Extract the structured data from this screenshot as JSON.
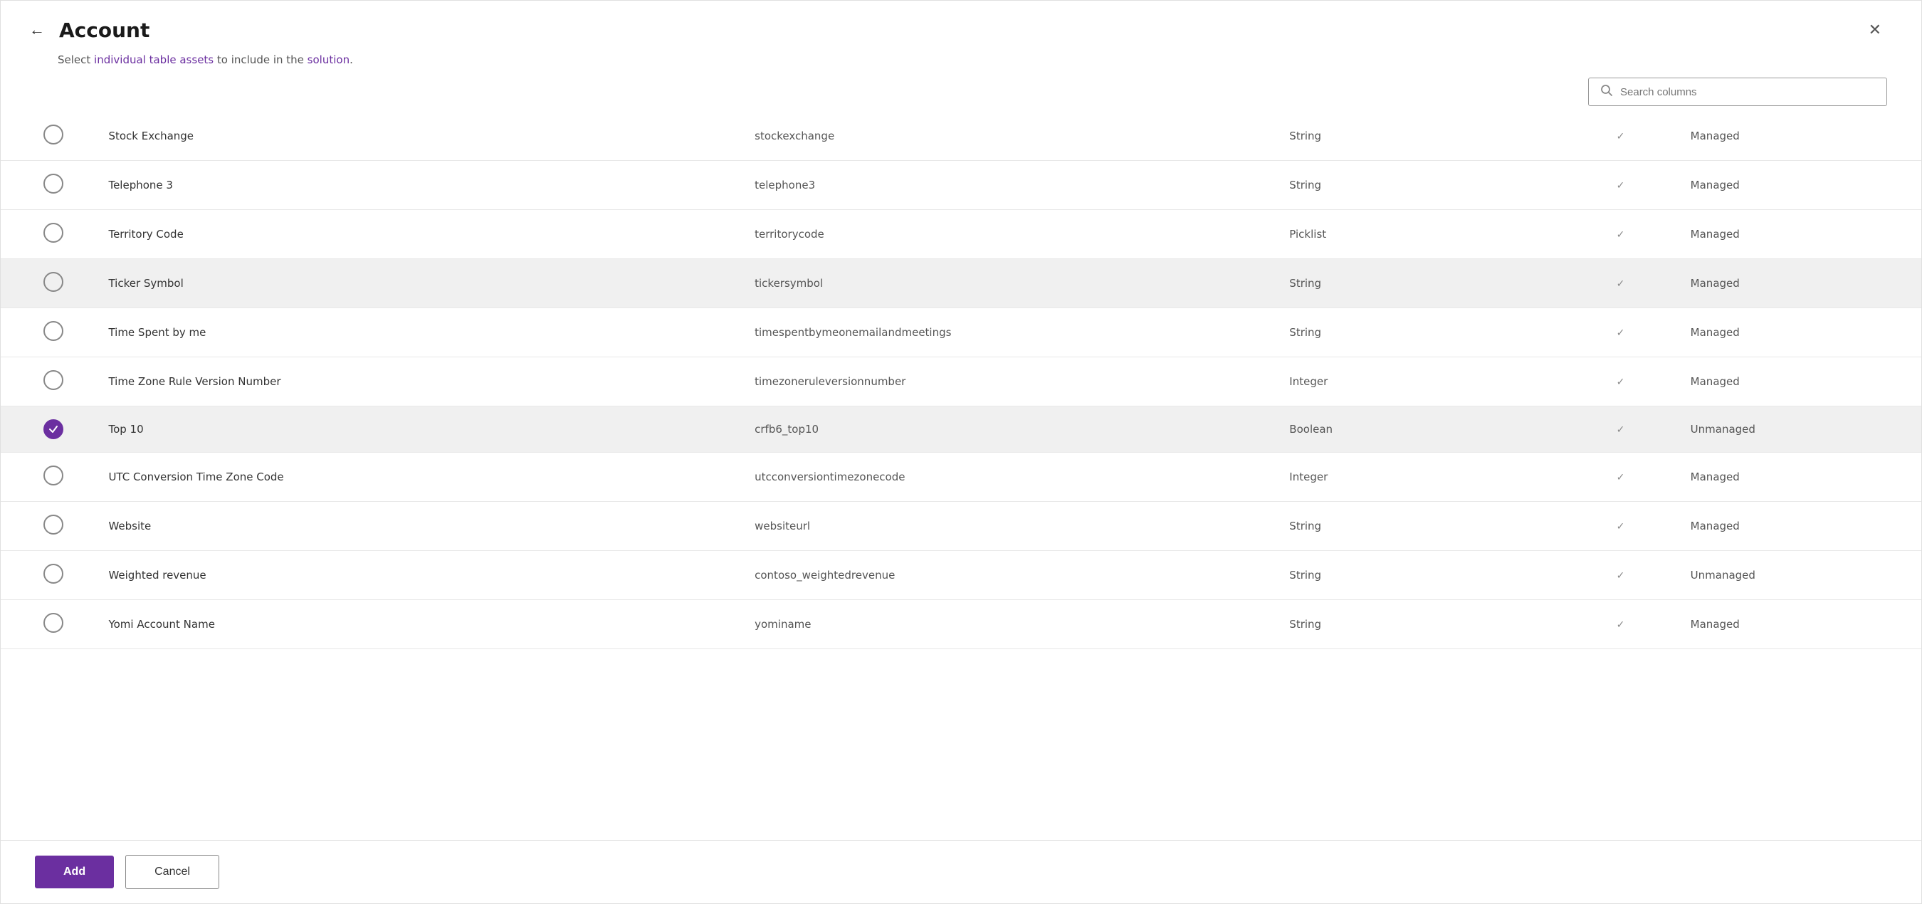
{
  "header": {
    "title": "Account",
    "back_label": "←",
    "close_label": "✕"
  },
  "subtitle": {
    "text_before": "Select ",
    "highlight1": "individual table assets",
    "text_middle": " to include in the ",
    "highlight2": "solution",
    "text_after": "."
  },
  "search": {
    "placeholder": "Search columns"
  },
  "rows": [
    {
      "id": 1,
      "name": "Stock Exchange",
      "logical": "stockexchange",
      "type": "String",
      "has_check": true,
      "managed": "Managed",
      "selected": false,
      "highlighted": false
    },
    {
      "id": 2,
      "name": "Telephone 3",
      "logical": "telephone3",
      "type": "String",
      "has_check": true,
      "managed": "Managed",
      "selected": false,
      "highlighted": false
    },
    {
      "id": 3,
      "name": "Territory Code",
      "logical": "territorycode",
      "type": "Picklist",
      "has_check": true,
      "managed": "Managed",
      "selected": false,
      "highlighted": false
    },
    {
      "id": 4,
      "name": "Ticker Symbol",
      "logical": "tickersymbol",
      "type": "String",
      "has_check": true,
      "managed": "Managed",
      "selected": false,
      "highlighted": true
    },
    {
      "id": 5,
      "name": "Time Spent by me",
      "logical": "timespentbymeonemailandmeetings",
      "type": "String",
      "has_check": true,
      "managed": "Managed",
      "selected": false,
      "highlighted": false
    },
    {
      "id": 6,
      "name": "Time Zone Rule Version Number",
      "logical": "timezoneruleversionnumber",
      "type": "Integer",
      "has_check": true,
      "managed": "Managed",
      "selected": false,
      "highlighted": false
    },
    {
      "id": 7,
      "name": "Top 10",
      "logical": "crfb6_top10",
      "type": "Boolean",
      "has_check": true,
      "managed": "Unmanaged",
      "selected": true,
      "highlighted": true
    },
    {
      "id": 8,
      "name": "UTC Conversion Time Zone Code",
      "logical": "utcconversiontimezonecode",
      "type": "Integer",
      "has_check": true,
      "managed": "Managed",
      "selected": false,
      "highlighted": false
    },
    {
      "id": 9,
      "name": "Website",
      "logical": "websiteurl",
      "type": "String",
      "has_check": true,
      "managed": "Managed",
      "selected": false,
      "highlighted": false
    },
    {
      "id": 10,
      "name": "Weighted revenue",
      "logical": "contoso_weightedrevenue",
      "type": "String",
      "has_check": true,
      "managed": "Unmanaged",
      "selected": false,
      "highlighted": false
    },
    {
      "id": 11,
      "name": "Yomi Account Name",
      "logical": "yominame",
      "type": "String",
      "has_check": true,
      "managed": "Managed",
      "selected": false,
      "highlighted": false
    }
  ],
  "footer": {
    "add_label": "Add",
    "cancel_label": "Cancel"
  }
}
